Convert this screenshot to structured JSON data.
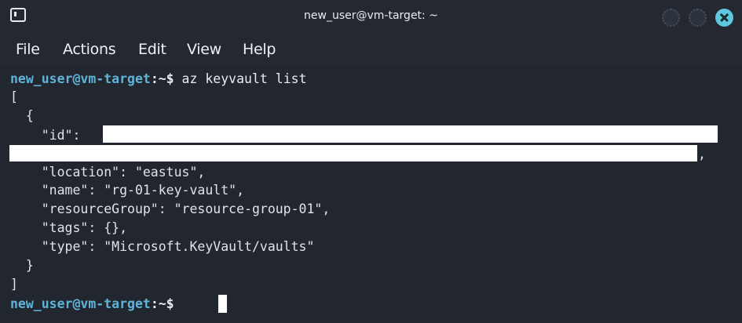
{
  "window": {
    "title": "new_user@vm-target: ~",
    "icon": "terminal-icon",
    "controls": [
      "minimize-icon",
      "maximize-icon",
      "close-icon"
    ],
    "accent_color": "#5ec8de"
  },
  "menu": {
    "file": "File",
    "actions": "Actions",
    "edit": "Edit",
    "view": "View",
    "help": "Help"
  },
  "terminal": {
    "prompt_user": "new_user@vm-target",
    "prompt_sep": ":",
    "prompt_path": "~$",
    "command": " az keyvault list",
    "output": {
      "open_bracket": "[",
      "open_brace": "  {",
      "id_key": "    \"id\": ",
      "id_line2_tail": ",",
      "location": "    \"location\": \"eastus\",",
      "name": "    \"name\": \"rg-01-key-vault\",",
      "resource_group": "    \"resourceGroup\": \"resource-group-01\",",
      "tags": "    \"tags\": {},",
      "type": "    \"type\": \"Microsoft.KeyVault/vaults\"",
      "close_brace": "  }",
      "close_bracket": "]"
    },
    "prompt2_user": "new_user@vm-target",
    "prompt2_sep": ":",
    "prompt2_path": "~$",
    "colors": {
      "user": "#5fb3d9",
      "text": "#dfe3ea",
      "background": "#21262f"
    }
  }
}
